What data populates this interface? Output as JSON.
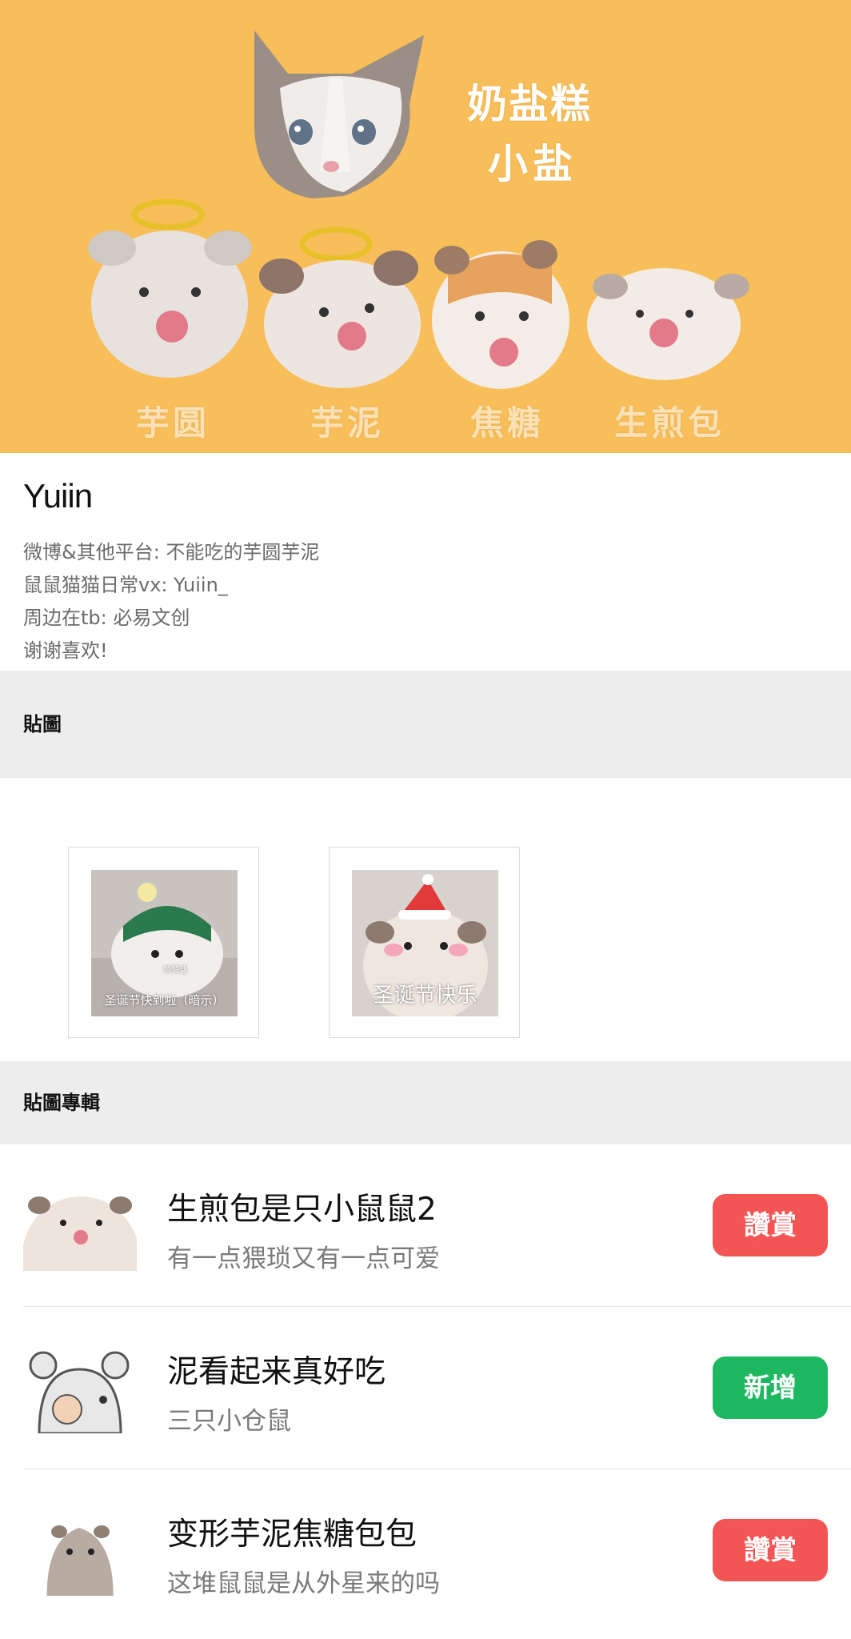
{
  "banner": {
    "title_line1": "奶盐糕",
    "title_line2": "小盐",
    "hamster_names": [
      "芋圆",
      "芋泥",
      "焦糖",
      "生煎包"
    ],
    "background_color": "#F8BE5A"
  },
  "profile": {
    "name": "Yuiin",
    "lines": [
      "微博&其他平台: 不能吃的芋圆芋泥",
      "鼠鼠猫猫日常vx: Yuiin_",
      "周边在tb: 必易文创",
      "谢谢喜欢!"
    ]
  },
  "sections": {
    "stickers_header": "貼圖",
    "albums_header": "貼圖專輯"
  },
  "stickers": [
    {
      "caption": "圣诞节快到啦（暗示）",
      "small_text": "悄悄话"
    },
    {
      "caption": "圣诞节快乐"
    }
  ],
  "albums": [
    {
      "title": "生煎包是只小鼠鼠2",
      "subtitle": "有一点猥琐又有一点可爱",
      "button": "讚賞",
      "button_color": "#F35454"
    },
    {
      "title": "泥看起来真好吃",
      "subtitle": "三只小仓鼠",
      "button": "新增",
      "button_color": "#1DB85F"
    },
    {
      "title": "变形芋泥焦糖包包",
      "subtitle": "这堆鼠鼠是从外星来的吗",
      "button": "讚賞",
      "button_color": "#F35454"
    }
  ]
}
